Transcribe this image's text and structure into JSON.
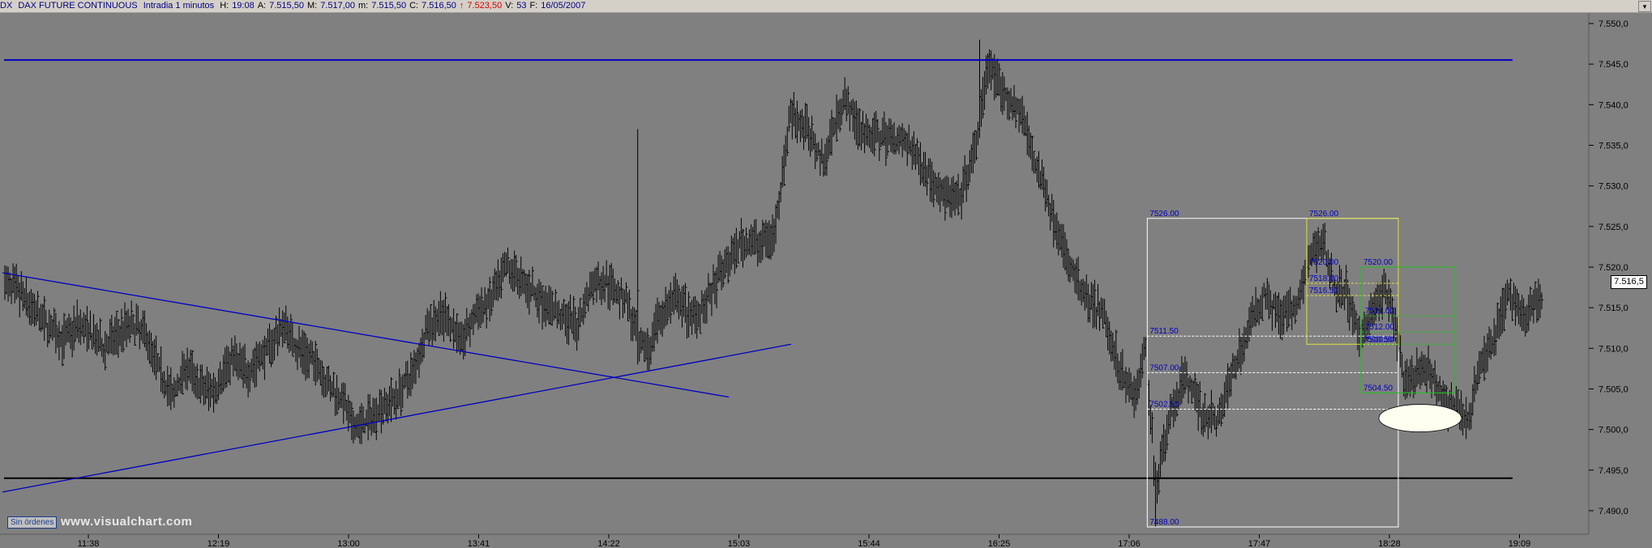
{
  "header": {
    "symbol": "DX",
    "name": "DAX FUTURE CONTINUOUS",
    "interval": "Intradia 1 minutos",
    "items": [
      {
        "k": "H:",
        "v": "19:08"
      },
      {
        "k": "A:",
        "v": "7.515,50"
      },
      {
        "k": "M:",
        "v": "7.517,00"
      },
      {
        "k": "m:",
        "v": "7.515,50"
      },
      {
        "k": "C:",
        "v": "7.516,50"
      }
    ],
    "red_items": [
      "↑",
      "7.523,50"
    ],
    "tail": [
      {
        "k": "V:",
        "v": "53"
      },
      {
        "k": "F:",
        "v": "16/05/2007"
      }
    ]
  },
  "current_price": "7.516,5",
  "status": {
    "orders": "Sin órdenes",
    "watermark": "www.visualchart.com"
  },
  "colors": {
    "bg": "#808080",
    "bars": "#000000",
    "trend": "#0000c0",
    "grid": "#6a6a6a",
    "white": "#ffffff",
    "yellow": "#e0e040",
    "green": "#20c020"
  },
  "chart_data": {
    "type": "ohlc",
    "y_ticks": [
      "7.490,0",
      "7.495,0",
      "7.500,0",
      "7.505,0",
      "7.510,0",
      "7.515,0",
      "7.520,0",
      "7.525,0",
      "7.530,0",
      "7.535,0",
      "7.540,0",
      "7.545,0",
      "7.550,0"
    ],
    "ylim": [
      7487.5,
      7551
    ],
    "x_ticks": [
      "11:38",
      "12:19",
      "13:00",
      "13:41",
      "14:22",
      "15:03",
      "15:44",
      "16:25",
      "17:06",
      "17:47",
      "18:28",
      "19:09"
    ],
    "price_path": [
      [
        0,
        7518
      ],
      [
        8,
        7517
      ],
      [
        20,
        7514
      ],
      [
        35,
        7511
      ],
      [
        45,
        7513
      ],
      [
        60,
        7510
      ],
      [
        75,
        7513
      ],
      [
        85,
        7512
      ],
      [
        95,
        7507
      ],
      [
        102,
        7504
      ],
      [
        110,
        7508
      ],
      [
        120,
        7505
      ],
      [
        128,
        7505
      ],
      [
        138,
        7509
      ],
      [
        148,
        7507
      ],
      [
        160,
        7510
      ],
      [
        170,
        7513
      ],
      [
        178,
        7510
      ],
      [
        190,
        7508
      ],
      [
        198,
        7505
      ],
      [
        205,
        7504
      ],
      [
        212,
        7500
      ],
      [
        220,
        7501
      ],
      [
        230,
        7503
      ],
      [
        238,
        7504
      ],
      [
        248,
        7507
      ],
      [
        258,
        7513
      ],
      [
        268,
        7514
      ],
      [
        278,
        7511
      ],
      [
        286,
        7514
      ],
      [
        296,
        7516
      ],
      [
        306,
        7520
      ],
      [
        316,
        7518
      ],
      [
        326,
        7516
      ],
      [
        338,
        7514
      ],
      [
        348,
        7513
      ],
      [
        358,
        7518
      ],
      [
        368,
        7518
      ],
      [
        378,
        7516
      ],
      [
        386,
        7510
      ],
      [
        392,
        7510
      ],
      [
        398,
        7514
      ],
      [
        408,
        7516
      ],
      [
        418,
        7514
      ],
      [
        428,
        7516
      ],
      [
        438,
        7520
      ],
      [
        448,
        7523
      ],
      [
        458,
        7523
      ],
      [
        468,
        7524
      ],
      [
        478,
        7539
      ],
      [
        488,
        7537
      ],
      [
        498,
        7533
      ],
      [
        510,
        7541
      ],
      [
        520,
        7537
      ],
      [
        530,
        7536
      ],
      [
        540,
        7536
      ],
      [
        550,
        7535
      ],
      [
        560,
        7532
      ],
      [
        570,
        7529
      ],
      [
        580,
        7528
      ],
      [
        590,
        7534
      ],
      [
        598,
        7545
      ],
      [
        608,
        7541
      ],
      [
        618,
        7539
      ],
      [
        628,
        7532
      ],
      [
        638,
        7526
      ],
      [
        648,
        7520
      ],
      [
        658,
        7516
      ],
      [
        668,
        7514
      ],
      [
        678,
        7508
      ],
      [
        688,
        7504
      ],
      [
        694,
        7510
      ],
      [
        700,
        7493
      ],
      [
        708,
        7501
      ],
      [
        718,
        7507
      ],
      [
        728,
        7502
      ],
      [
        738,
        7501
      ],
      [
        748,
        7508
      ],
      [
        758,
        7513
      ],
      [
        766,
        7517
      ],
      [
        776,
        7514
      ],
      [
        786,
        7515
      ],
      [
        796,
        7522
      ],
      [
        802,
        7523
      ],
      [
        810,
        7517
      ],
      [
        816,
        7517
      ],
      [
        824,
        7511
      ],
      [
        832,
        7515
      ],
      [
        840,
        7517
      ],
      [
        846,
        7513
      ],
      [
        852,
        7505
      ],
      [
        860,
        7507
      ],
      [
        868,
        7507
      ],
      [
        876,
        7503
      ],
      [
        884,
        7503
      ],
      [
        890,
        7501
      ],
      [
        898,
        7508
      ],
      [
        906,
        7511
      ],
      [
        914,
        7517
      ],
      [
        924,
        7514
      ],
      [
        932,
        7516
      ]
    ],
    "spikes": [
      {
        "i": 385,
        "hi": 7537,
        "lo": 7508
      },
      {
        "i": 593,
        "hi": 7548,
        "lo": 7538
      },
      {
        "i": 700,
        "hi": 7496,
        "lo": 7488
      }
    ],
    "levels": {
      "resistance": 7545.5,
      "support": 7494,
      "box_white": {
        "top": 7526,
        "bottom": 7488
      },
      "box_yellow": {
        "top": 7526,
        "bottom": 7510.5
      },
      "box_green": {
        "top": 7520,
        "bottom": 7504.5
      }
    },
    "labels": [
      {
        "text": "7526.00",
        "x": 695,
        "y": 7526
      },
      {
        "text": "7511.50",
        "x": 695,
        "y": 7511.5
      },
      {
        "text": "7507.00",
        "x": 695,
        "y": 7507
      },
      {
        "text": "7502.50",
        "x": 695,
        "y": 7502.5
      },
      {
        "text": "7488.00",
        "x": 695,
        "y": 7488
      },
      {
        "text": "7526.00",
        "x": 792,
        "y": 7526
      },
      {
        "text": "7520.00",
        "x": 792,
        "y": 7520
      },
      {
        "text": "7518.00",
        "x": 792,
        "y": 7518
      },
      {
        "text": "7516.50",
        "x": 792,
        "y": 7516.5
      },
      {
        "text": "7510.50",
        "x": 825,
        "y": 7510.5
      },
      {
        "text": "7520.00",
        "x": 825,
        "y": 7520
      },
      {
        "text": "7514.00",
        "x": 826,
        "y": 7514
      },
      {
        "text": "7512.00",
        "x": 826,
        "y": 7512
      },
      {
        "text": "7510.50",
        "x": 826,
        "y": 7510.5
      },
      {
        "text": "7504.50",
        "x": 825,
        "y": 7504.5
      }
    ]
  }
}
